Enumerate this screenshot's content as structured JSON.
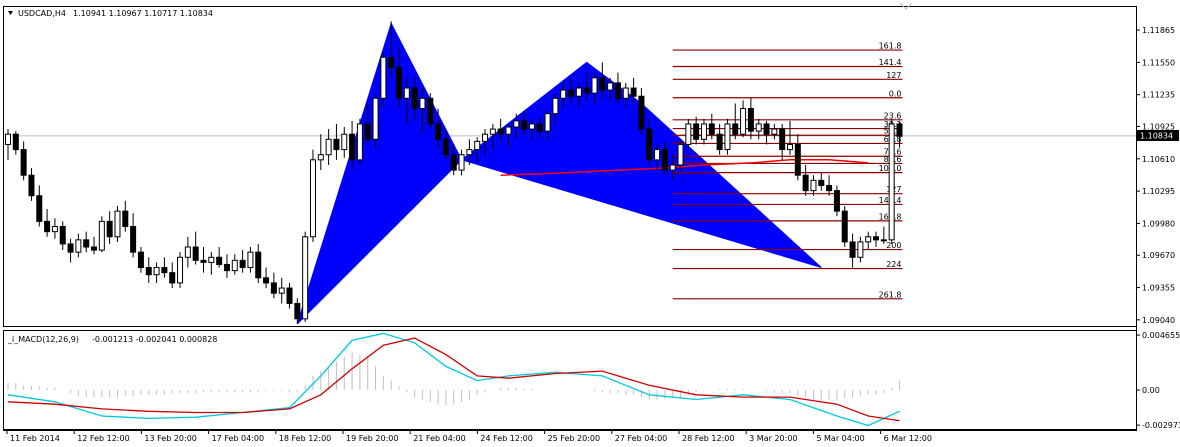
{
  "main_header": {
    "symbol_label": "USDCAD,H4",
    "ohlc_text": "1.10941 1.10967 1.10717 1.10834"
  },
  "current_price_label": "1.10834",
  "macd_header": {
    "indicator_label": "_i_MACD(12,26,9)",
    "values_text": "-0.001213 -0.002041 0.000828"
  },
  "chart_data": [
    {
      "type": "candlestick",
      "title": "USDCAD,H4",
      "ylim": [
        1.0898,
        1.1209
      ],
      "price_ticks": [
        {
          "value": 1.11865,
          "label": "1.11865"
        },
        {
          "value": 1.1155,
          "label": "1.11550"
        },
        {
          "value": 1.11235,
          "label": "1.11235"
        },
        {
          "value": 1.10925,
          "label": "1.10925"
        },
        {
          "value": 1.1061,
          "label": "1.10610"
        },
        {
          "value": 1.10295,
          "label": "1.10295"
        },
        {
          "value": 1.0998,
          "label": "1.09980"
        },
        {
          "value": 1.0967,
          "label": "1.09670"
        },
        {
          "value": 1.09355,
          "label": "1.09355"
        },
        {
          "value": 1.0904,
          "label": "1.09040"
        }
      ],
      "time_ticks": [
        "11 Feb 2014",
        "12 Feb 12:00",
        "13 Feb 20:00",
        "17 Feb 04:00",
        "18 Feb 12:00",
        "19 Feb 20:00",
        "21 Feb 04:00",
        "24 Feb 12:00",
        "25 Feb 20:00",
        "27 Feb 04:00",
        "28 Feb 12:00",
        "3 Mar 20:00",
        "5 Mar 04:00",
        "6 Mar 12:00"
      ],
      "current_price": 1.10834,
      "candles": [
        [
          1.1075,
          1.109,
          1.106,
          1.1085
        ],
        [
          1.1085,
          1.1088,
          1.1065,
          1.107
        ],
        [
          1.107,
          1.1078,
          1.104,
          1.1045
        ],
        [
          1.1045,
          1.1052,
          1.102,
          1.1025
        ],
        [
          1.1025,
          1.1035,
          1.0995,
          1.1
        ],
        [
          1.1,
          1.1012,
          1.0985,
          1.099
        ],
        [
          1.099,
          1.1003,
          1.0983,
          1.0995
        ],
        [
          1.0995,
          1.1,
          1.0972,
          1.0978
        ],
        [
          1.0978,
          1.0983,
          1.096,
          1.097
        ],
        [
          1.097,
          1.0988,
          1.0965,
          1.0982
        ],
        [
          1.0982,
          1.099,
          1.097,
          1.0975
        ],
        [
          1.0975,
          1.0985,
          1.0968,
          1.0972
        ],
        [
          1.0972,
          1.1005,
          1.097,
          1.1
        ],
        [
          1.1,
          1.101,
          1.0978,
          1.0985
        ],
        [
          1.0985,
          1.1015,
          1.098,
          1.101
        ],
        [
          1.101,
          1.102,
          1.099,
          1.0995
        ],
        [
          1.0995,
          1.1008,
          1.0965,
          1.097
        ],
        [
          1.097,
          1.0975,
          1.095,
          1.0955
        ],
        [
          1.0955,
          1.0965,
          1.094,
          1.0948
        ],
        [
          1.0948,
          1.096,
          1.094,
          1.0955
        ],
        [
          1.0955,
          1.0965,
          1.0945,
          1.095
        ],
        [
          1.095,
          1.096,
          1.0935,
          1.094
        ],
        [
          1.094,
          1.097,
          1.0935,
          1.0965
        ],
        [
          1.0965,
          1.0985,
          1.0955,
          1.0975
        ],
        [
          1.0975,
          1.099,
          1.0958,
          1.0962
        ],
        [
          1.0962,
          1.0975,
          1.095,
          1.096
        ],
        [
          1.096,
          1.097,
          1.0948,
          1.0965
        ],
        [
          1.0965,
          1.0975,
          1.0955,
          1.0958
        ],
        [
          1.0958,
          1.0968,
          1.0945,
          1.0952
        ],
        [
          1.0952,
          1.0968,
          1.0948,
          1.0962
        ],
        [
          1.0962,
          1.0972,
          1.095,
          1.0955
        ],
        [
          1.0955,
          1.0975,
          1.095,
          1.097
        ],
        [
          1.097,
          1.0978,
          1.094,
          1.0945
        ],
        [
          1.0945,
          1.0955,
          1.0935,
          1.094
        ],
        [
          1.094,
          1.095,
          1.0925,
          1.093
        ],
        [
          1.093,
          1.0945,
          1.092,
          1.0935
        ],
        [
          1.0935,
          1.094,
          1.0915,
          1.092
        ],
        [
          1.092,
          1.0925,
          1.09,
          1.0905
        ],
        [
          1.0905,
          1.099,
          1.0902,
          1.0985
        ],
        [
          1.0985,
          1.107,
          1.098,
          1.106
        ],
        [
          1.106,
          1.1085,
          1.105,
          1.1065
        ],
        [
          1.1065,
          1.109,
          1.1055,
          1.108
        ],
        [
          1.108,
          1.1095,
          1.106,
          1.107
        ],
        [
          1.107,
          1.1092,
          1.1062,
          1.1085
        ],
        [
          1.1085,
          1.1098,
          1.105,
          1.106
        ],
        [
          1.106,
          1.11,
          1.1055,
          1.1095
        ],
        [
          1.1095,
          1.1115,
          1.1075,
          1.108
        ],
        [
          1.108,
          1.1125,
          1.107,
          1.112
        ],
        [
          1.112,
          1.1165,
          1.111,
          1.116
        ],
        [
          1.116,
          1.1195,
          1.114,
          1.115
        ],
        [
          1.115,
          1.117,
          1.111,
          1.112
        ],
        [
          1.112,
          1.114,
          1.1095,
          1.113
        ],
        [
          1.113,
          1.114,
          1.11,
          1.111
        ],
        [
          1.111,
          1.113,
          1.1085,
          1.112
        ],
        [
          1.112,
          1.1125,
          1.109,
          1.1095
        ],
        [
          1.1095,
          1.111,
          1.107,
          1.108
        ],
        [
          1.108,
          1.109,
          1.106,
          1.1065
        ],
        [
          1.1065,
          1.1075,
          1.1045,
          1.105
        ],
        [
          1.105,
          1.107,
          1.1045,
          1.1065
        ],
        [
          1.1065,
          1.108,
          1.1055,
          1.107
        ],
        [
          1.107,
          1.1082,
          1.1058,
          1.1078
        ],
        [
          1.1078,
          1.109,
          1.1065,
          1.1085
        ],
        [
          1.1085,
          1.1095,
          1.107,
          1.109
        ],
        [
          1.109,
          1.11,
          1.1078,
          1.1085
        ],
        [
          1.1085,
          1.1095,
          1.1072,
          1.1092
        ],
        [
          1.1092,
          1.1105,
          1.108,
          1.1098
        ],
        [
          1.1098,
          1.1108,
          1.1085,
          1.109
        ],
        [
          1.109,
          1.11,
          1.1078,
          1.1095
        ],
        [
          1.1095,
          1.1102,
          1.1082,
          1.1088
        ],
        [
          1.1088,
          1.1108,
          1.108,
          1.1105
        ],
        [
          1.1105,
          1.1125,
          1.1095,
          1.112
        ],
        [
          1.112,
          1.1135,
          1.111,
          1.1128
        ],
        [
          1.1128,
          1.114,
          1.1115,
          1.1122
        ],
        [
          1.1122,
          1.1135,
          1.1112,
          1.113
        ],
        [
          1.113,
          1.1145,
          1.1118,
          1.1125
        ],
        [
          1.1125,
          1.1145,
          1.1115,
          1.114
        ],
        [
          1.114,
          1.1155,
          1.112,
          1.1128
        ],
        [
          1.1128,
          1.114,
          1.1118,
          1.1135
        ],
        [
          1.1135,
          1.1145,
          1.1115,
          1.112
        ],
        [
          1.112,
          1.1135,
          1.1112,
          1.113
        ],
        [
          1.113,
          1.114,
          1.1115,
          1.1122
        ],
        [
          1.1122,
          1.113,
          1.1085,
          1.109
        ],
        [
          1.109,
          1.11,
          1.1055,
          1.106
        ],
        [
          1.106,
          1.1075,
          1.105,
          1.107
        ],
        [
          1.107,
          1.1078,
          1.1045,
          1.105
        ],
        [
          1.105,
          1.1065,
          1.104,
          1.1055
        ],
        [
          1.1055,
          1.108,
          1.1048,
          1.1075
        ],
        [
          1.1075,
          1.11,
          1.107,
          1.1095
        ],
        [
          1.1095,
          1.1102,
          1.1075,
          1.108
        ],
        [
          1.108,
          1.11,
          1.1075,
          1.1095
        ],
        [
          1.1095,
          1.1105,
          1.108,
          1.1085
        ],
        [
          1.1085,
          1.1095,
          1.1065,
          1.107
        ],
        [
          1.107,
          1.11,
          1.1065,
          1.1095
        ],
        [
          1.1095,
          1.1115,
          1.108,
          1.1085
        ],
        [
          1.1085,
          1.1118,
          1.1082,
          1.111
        ],
        [
          1.111,
          1.112,
          1.108,
          1.1088
        ],
        [
          1.1088,
          1.11,
          1.108,
          1.1095
        ],
        [
          1.1095,
          1.1098,
          1.1075,
          1.1085
        ],
        [
          1.1085,
          1.1095,
          1.108,
          1.109
        ],
        [
          1.109,
          1.1095,
          1.106,
          1.107
        ],
        [
          1.107,
          1.1098,
          1.1065,
          1.1075
        ],
        [
          1.1075,
          1.1085,
          1.104,
          1.1045
        ],
        [
          1.1045,
          1.1055,
          1.1025,
          1.103
        ],
        [
          1.103,
          1.1045,
          1.1025,
          1.104
        ],
        [
          1.104,
          1.1048,
          1.103,
          1.1035
        ],
        [
          1.1035,
          1.1045,
          1.1025,
          1.103
        ],
        [
          1.103,
          1.1035,
          1.1005,
          1.101
        ],
        [
          1.101,
          1.1015,
          1.0975,
          1.098
        ],
        [
          1.098,
          1.0988,
          1.0955,
          1.0965
        ],
        [
          1.0965,
          1.0985,
          1.096,
          1.098
        ],
        [
          1.098,
          1.099,
          1.0972,
          1.0985
        ],
        [
          1.0985,
          1.099,
          1.0975,
          1.0982
        ],
        [
          1.0982,
          1.0995,
          1.0978,
          1.0982
        ],
        [
          1.0982,
          1.11,
          1.0978,
          1.1095
        ],
        [
          1.1095,
          1.1097,
          1.1072,
          1.1083
        ]
      ],
      "harmonic_patterns": [
        {
          "points": [
            [
              37,
              1.09
            ],
            [
              49,
              1.1193
            ],
            [
              58,
              1.106
            ]
          ],
          "color": "#0000ff"
        },
        {
          "points": [
            [
              58,
              1.106
            ],
            [
              74,
              1.1155
            ],
            [
              81,
              1.1115
            ]
          ],
          "color": "#0000ff"
        },
        {
          "points": [
            [
              58,
              1.106
            ],
            [
              81,
              1.1115
            ],
            [
              104,
              1.0955
            ]
          ],
          "color": "#0000ff"
        }
      ],
      "moving_average": {
        "color": "#ff0000",
        "points": [
          [
            63,
            1.1045
          ],
          [
            70,
            1.1047
          ],
          [
            78,
            1.105
          ],
          [
            84,
            1.1052
          ],
          [
            89,
            1.1055
          ],
          [
            95,
            1.1057
          ],
          [
            100,
            1.106
          ],
          [
            105,
            1.106
          ],
          [
            110,
            1.1057
          ]
        ]
      },
      "fib_levels_start_bar": 85,
      "fib_levels_end_bar": 114,
      "fib_color": "#8b0000",
      "fib_levels": [
        {
          "label": "161.8",
          "value": 1.1167
        },
        {
          "label": "141.4",
          "value": 1.1151
        },
        {
          "label": "127",
          "value": 1.11385
        },
        {
          "label": "0.0",
          "value": 1.11205
        },
        {
          "label": "23.6",
          "value": 1.1099
        },
        {
          "label": "38.2",
          "value": 1.10905
        },
        {
          "label": "50.0",
          "value": 1.1084
        },
        {
          "label": "61.8",
          "value": 1.1076
        },
        {
          "label": "78.6",
          "value": 1.10635
        },
        {
          "label": "88.6",
          "value": 1.10565
        },
        {
          "label": "100.0",
          "value": 1.10475
        },
        {
          "label": "127",
          "value": 1.1027
        },
        {
          "label": "141.4",
          "value": 1.10165
        },
        {
          "label": "161.8",
          "value": 1.10005
        },
        {
          "label": "200",
          "value": 1.09725
        },
        {
          "label": "224",
          "value": 1.0954
        },
        {
          "label": "261.8",
          "value": 1.09245
        }
      ]
    },
    {
      "type": "line",
      "title": "_i_MACD(12,26,9)",
      "ylim": [
        -0.0033,
        0.005
      ],
      "value_ticks": [
        {
          "value": 0.004655,
          "label": "0.004655"
        },
        {
          "value": 0.0,
          "label": "0.00"
        },
        {
          "value": -0.002973,
          "label": "-0.002973"
        }
      ],
      "histogram_color": "#c0c0c0",
      "series": [
        {
          "color": "#00c8e0",
          "x": [
            0,
            6,
            12,
            18,
            24,
            30,
            36,
            40,
            44,
            48,
            52,
            56,
            60,
            64,
            70,
            76,
            82,
            88,
            94,
            100,
            106,
            110,
            114
          ],
          "values": [
            -0.0004,
            -0.001,
            -0.0022,
            -0.0024,
            -0.0023,
            -0.0019,
            -0.0015,
            0.0012,
            0.0042,
            0.0048,
            0.004,
            0.002,
            0.0008,
            0.0012,
            0.0015,
            0.0012,
            -0.0004,
            -0.0008,
            -0.0004,
            -0.0008,
            -0.0022,
            -0.003,
            -0.0018
          ]
        },
        {
          "color": "#d00000",
          "x": [
            0,
            6,
            12,
            18,
            24,
            30,
            36,
            40,
            44,
            48,
            52,
            56,
            60,
            64,
            70,
            76,
            82,
            88,
            94,
            100,
            106,
            110,
            114
          ],
          "values": [
            -0.001,
            -0.0012,
            -0.0016,
            -0.0018,
            -0.0019,
            -0.0019,
            -0.0016,
            -0.0004,
            0.0018,
            0.0038,
            0.0044,
            0.003,
            0.0012,
            0.001,
            0.0014,
            0.0016,
            0.0004,
            -0.0004,
            -0.0006,
            -0.0006,
            -0.0012,
            -0.0022,
            -0.0026
          ]
        }
      ],
      "histogram": [
        0.0006,
        0.0006,
        0.0004,
        0.0004,
        0.0003,
        0.0002,
        0.0002,
        0.0,
        -0.0003,
        -0.0005,
        -0.0006,
        -0.0006,
        -0.0006,
        -0.0006,
        -0.0006,
        -0.0005,
        -0.0005,
        -0.0004,
        -0.0004,
        -0.0004,
        -0.0004,
        -0.0003,
        -0.0003,
        -0.0003,
        -0.0003,
        -0.0002,
        -0.0002,
        -0.0002,
        -0.0002,
        -0.0002,
        -0.0002,
        -0.0002,
        -0.0002,
        -0.0001,
        -0.0001,
        -0.0001,
        -0.0002,
        -0.0002,
        0.0004,
        0.0012,
        0.0016,
        0.002,
        0.0024,
        0.0028,
        0.0032,
        0.003,
        0.0028,
        0.002,
        0.0012,
        0.0008,
        0.0003,
        -0.0002,
        -0.0006,
        -0.0008,
        -0.001,
        -0.0012,
        -0.0013,
        -0.0012,
        -0.001,
        -0.0008,
        -0.0004,
        -0.0002,
        0.0,
        0.0002,
        0.0002,
        0.0002,
        0.0001,
        0.0001,
        0.0,
        0.0,
        0.0,
        0.0,
        0.0,
        0.0,
        0.0,
        -0.0001,
        -0.0002,
        -0.0003,
        -0.0003,
        -0.0004,
        -0.0004,
        -0.0006,
        -0.0008,
        -0.0008,
        -0.0008,
        -0.0007,
        -0.0006,
        -0.0004,
        -0.0002,
        -0.0001,
        0.0,
        0.0001,
        0.0001,
        0.0001,
        0.0001,
        0.0,
        0.0,
        -0.0001,
        -0.0002,
        -0.0003,
        -0.0003,
        -0.0005,
        -0.0006,
        -0.0008,
        -0.0008,
        -0.0008,
        -0.0008,
        -0.0007,
        -0.0006,
        -0.0005,
        -0.0004,
        -0.0004,
        -0.0003,
        0.0002,
        0.0008
      ]
    }
  ]
}
